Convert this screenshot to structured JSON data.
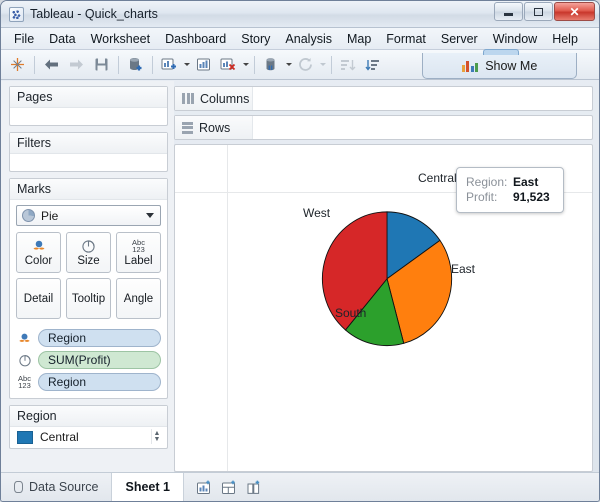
{
  "window": {
    "title": "Tableau - Quick_charts",
    "app_icon": "tableau-logo-icon",
    "controls": {
      "minimize": "minimize-icon",
      "maximize": "restore-icon",
      "close": "✕"
    }
  },
  "menubar": {
    "items": [
      "File",
      "Data",
      "Worksheet",
      "Dashboard",
      "Story",
      "Analysis",
      "Map",
      "Format",
      "Server",
      "Window",
      "Help"
    ]
  },
  "toolbar": {
    "show_me_label": "Show Me",
    "buttons": [
      "tableau-logo-icon",
      "back-arrow-icon",
      "forward-arrow-icon",
      "save-icon",
      "new-data-source-icon",
      "new-worksheet-icon",
      "duplicate-sheet-icon",
      "clear-sheet-icon",
      "clear-filters-icon",
      "refresh-icon",
      "sort-ascending-icon",
      "sort-descending-icon"
    ]
  },
  "sidebar": {
    "pages": {
      "title": "Pages"
    },
    "filters": {
      "title": "Filters"
    },
    "marks": {
      "title": "Marks",
      "mark_type": "Pie",
      "buttons": [
        {
          "label": "Color",
          "icon": "color-icon"
        },
        {
          "label": "Size",
          "icon": "size-icon"
        },
        {
          "label": "Label",
          "icon": "abc-123-icon"
        },
        {
          "label": "Detail",
          "icon": "detail-icon"
        },
        {
          "label": "Tooltip",
          "icon": "tooltip-icon"
        },
        {
          "label": "Angle",
          "icon": "angle-icon"
        }
      ],
      "pills": [
        {
          "label": "Region",
          "icon": "color-icon",
          "kind": "dimension"
        },
        {
          "label": "SUM(Profit)",
          "icon": "angle-icon",
          "kind": "measure"
        },
        {
          "label": "Region",
          "icon": "abc-123-icon",
          "kind": "dimension"
        }
      ]
    },
    "legend": {
      "title": "Region",
      "entries": [
        {
          "label": "Central",
          "color": "#1f77b4"
        }
      ]
    }
  },
  "shelves": {
    "columns": {
      "label": "Columns",
      "value": ""
    },
    "rows": {
      "label": "Rows",
      "value": ""
    }
  },
  "tooltip": {
    "region_key": "Region:",
    "region_value": "East",
    "profit_key": "Profit:",
    "profit_value": "91,523"
  },
  "statusbar": {
    "data_source_label": "Data Source",
    "sheet_label": "Sheet 1",
    "icons": [
      "new-worksheet-icon",
      "new-dashboard-icon",
      "new-story-icon"
    ]
  },
  "chart_data": {
    "type": "pie",
    "title": "",
    "categories": [
      "Central",
      "East",
      "South",
      "West"
    ],
    "values": [
      39700,
      91523,
      39700,
      101000
    ],
    "angles_deg": [
      55,
      110,
      55,
      140
    ],
    "colors": [
      "#1f77b4",
      "#ff7f0e",
      "#2ca02c",
      "#d62728"
    ],
    "labels": [
      "Central",
      "East",
      "South",
      "West"
    ],
    "legend_position": "left-sidebar",
    "measure": "SUM(Profit)",
    "dimension": "Region",
    "highlighted": "East",
    "highlighted_value": "91,523",
    "start_angle_deg": 0,
    "grid": false
  }
}
